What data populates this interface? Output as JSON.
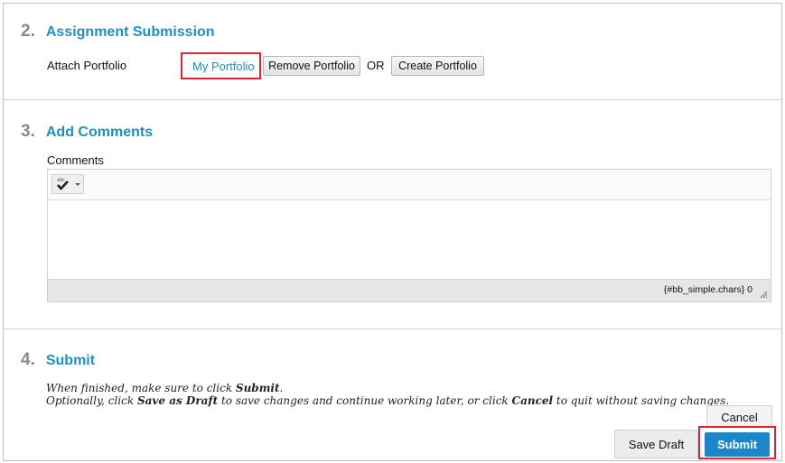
{
  "assignment_submission": {
    "number": "2.",
    "title": "Assignment Submission",
    "attach_label": "Attach Portfolio",
    "my_portfolio": "My Portfolio",
    "remove_portfolio": "Remove Portfolio",
    "or_text": "OR",
    "create_portfolio": "Create Portfolio"
  },
  "add_comments": {
    "number": "3.",
    "title": "Add Comments",
    "comments_label": "Comments",
    "spellcheck_icon_text": "ABC",
    "char_counter": "{#bb_simple.chars} 0"
  },
  "submit_section": {
    "number": "4.",
    "title": "Submit",
    "instruction_line1_prefix": "When finished, make sure to click ",
    "instruction_line1_bold": "Submit",
    "instruction_line1_suffix": ".",
    "instruction_line2_a": "Optionally, click ",
    "instruction_line2_b": "Save as Draft",
    "instruction_line2_c": " to save changes and continue working later, or click ",
    "instruction_line2_d": "Cancel",
    "instruction_line2_e": " to quit without saving changes.",
    "cancel": "Cancel",
    "save_draft": "Save Draft",
    "submit": "Submit"
  },
  "colors": {
    "heading_blue": "#1f8fbf",
    "submit_blue": "#1b87c9",
    "highlight_red": "#d9252f"
  }
}
